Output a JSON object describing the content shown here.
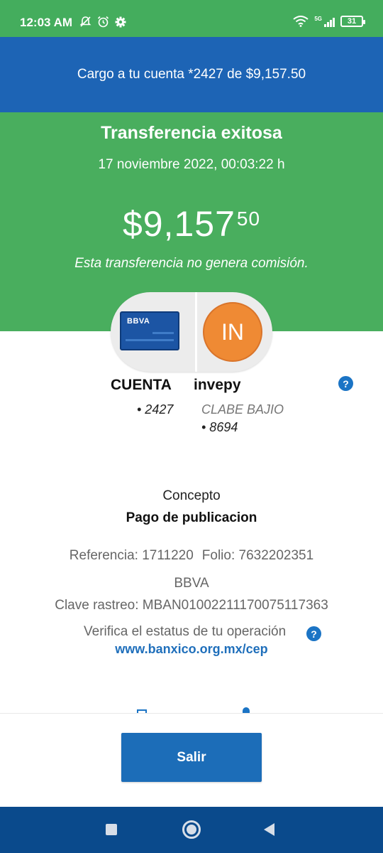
{
  "status_bar": {
    "time": "12:03 AM",
    "left_icons": [
      "notifications-off-icon",
      "alarm-icon",
      "settings-gear-icon"
    ],
    "right_icons": [
      "wifi-icon",
      "signal-5g-icon",
      "battery-icon"
    ],
    "network_label": "5G",
    "battery_level": "31"
  },
  "banner": {
    "charge_text": "Cargo a tu cuenta *2427 de $9,157.50"
  },
  "success": {
    "title": "Transferencia exitosa",
    "datetime": "17 noviembre 2022, 00:03:22 h",
    "amount_main": "$9,157",
    "amount_cents": "50",
    "no_fee_note": "Esta transferencia no genera comisión."
  },
  "transfer": {
    "from_card_brand": "BBVA",
    "from_label": "CUENTA",
    "from_account": "• 2427",
    "to_initials": "IN",
    "to_name": "invepy",
    "to_bank": "CLABE BAJIO",
    "to_account": "• 8694",
    "help_icon_text": "?"
  },
  "details": {
    "concept_label": "Concepto",
    "concept_value": "Pago de publicacion",
    "reference": "Referencia: 1711220",
    "folio": "Folio: 7632202351",
    "bank": "BBVA",
    "tracking_key": "Clave rastreo: MBAN01002211170075117363",
    "verify_text": "Verifica el estatus de tu operación",
    "verify_link": "www.banxico.org.mx/cep"
  },
  "actions": {
    "exit_label": "Salir"
  },
  "colors": {
    "status_green": "#44ad5d",
    "banner_blue": "#1d64b5",
    "success_green": "#49ae5e",
    "button_blue": "#1c6db8",
    "link_blue": "#1f6fbb",
    "avatar_orange": "#ef8a34",
    "nav_blue": "#0a4a8c"
  }
}
